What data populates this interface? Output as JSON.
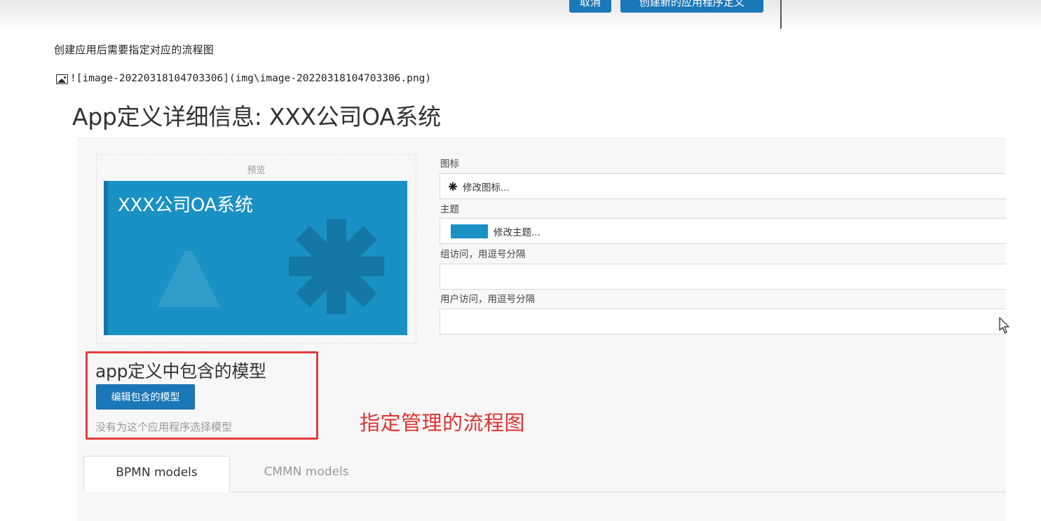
{
  "header": {
    "cancel_label": "取消",
    "create_label": "创建新的应用程序定义"
  },
  "markdown": {
    "text_line": "创建应用后需要指定对应的流程图",
    "image_syntax": "![image-20220318104703306](img\\image-20220318104703306.png)"
  },
  "page": {
    "title": "App定义详细信息: XXX公司OA系统"
  },
  "preview": {
    "label": "预览",
    "app_name": "XXX公司OA系统",
    "theme_color": "#1a91c4"
  },
  "form": {
    "icon_label": "图标",
    "icon_button": "修改图标...",
    "icon_name": "asterisk-icon",
    "theme_label": "主题",
    "theme_button": "修改主题...",
    "groups_label": "组访问，用逗号分隔",
    "groups_value": "",
    "users_label": "用户访问，用逗号分隔",
    "users_value": ""
  },
  "models": {
    "title": "app定义中包含的模型",
    "edit_button": "编辑包含的模型",
    "empty_text": "没有为这个应用程序选择模型",
    "annotation": "指定管理的流程图"
  },
  "tabs": [
    {
      "label": "BPMN models",
      "active": true
    },
    {
      "label": "CMMN models",
      "active": false
    }
  ],
  "colors": {
    "primary": "#1b78b8",
    "annotation_red": "#e43c3c"
  }
}
